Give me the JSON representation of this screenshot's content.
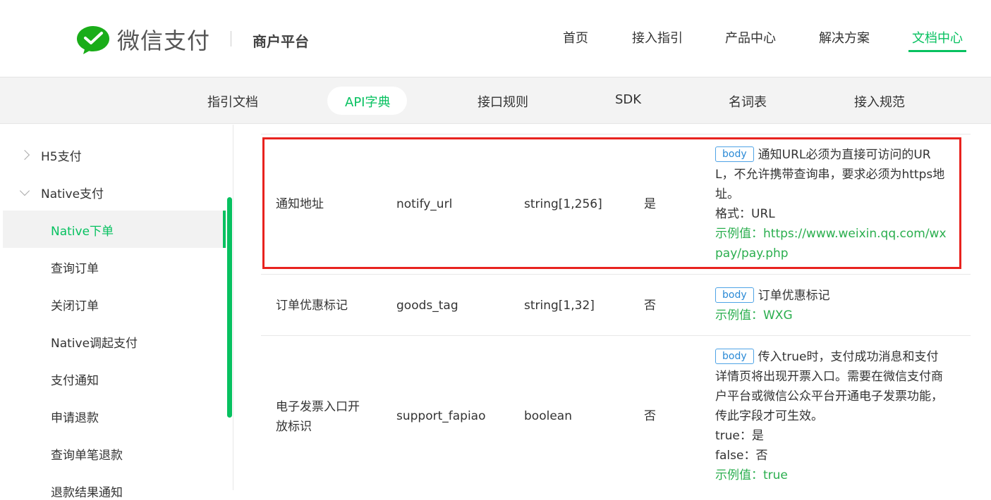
{
  "header": {
    "brand": "微信支付",
    "sub": "商户平台",
    "nav": [
      "首页",
      "接入指引",
      "产品中心",
      "解决方案",
      "文档中心"
    ],
    "active_nav": "文档中心"
  },
  "subnav": [
    "指引文档",
    "API字典",
    "接口规则",
    "SDK",
    "名词表",
    "接入规范"
  ],
  "sidebar": {
    "groups": [
      "H5支付",
      "Native支付"
    ],
    "items": [
      "Native下单",
      "查询订单",
      "关闭订单",
      "Native调起支付",
      "支付通知",
      "申请退款",
      "查询单笔退款",
      "退款结果通知"
    ]
  },
  "table": {
    "rows": [
      {
        "name": "通知地址",
        "param": "notify_url",
        "type": "string[1,256]",
        "required": "是",
        "tag": "body",
        "desc": [
          "通知URL必须为直接可访问的UR",
          "L，不允许携带查询串，要求必须为https地",
          "址。"
        ],
        "format": "格式：URL",
        "example": [
          "示例值：https://www.weixin.qq.com/wx",
          "pay/pay.php"
        ]
      },
      {
        "name": "订单优惠标记",
        "param": "goods_tag",
        "type": "string[1,32]",
        "required": "否",
        "tag": "body",
        "desc": [
          "订单优惠标记"
        ],
        "example": [
          "示例值：WXG"
        ]
      },
      {
        "name": [
          "电子发票入口开",
          "放标识"
        ],
        "param": "support_fapiao",
        "type": "boolean",
        "required": "否",
        "tag": "body",
        "desc": [
          "传入true时，支付成功消息和支付",
          "详情页将出现开票入口。需要在微信支付商",
          "户平台或微信公众平台开通电子发票功能，",
          "传此字段才可生效。",
          "true：是",
          "false：否"
        ],
        "example": [
          "示例值：true"
        ]
      }
    ]
  },
  "colors": {
    "accent": "#07c160",
    "highlight": "#e8231f",
    "tag": "#2b8ad6",
    "example": "#2aae4e"
  }
}
